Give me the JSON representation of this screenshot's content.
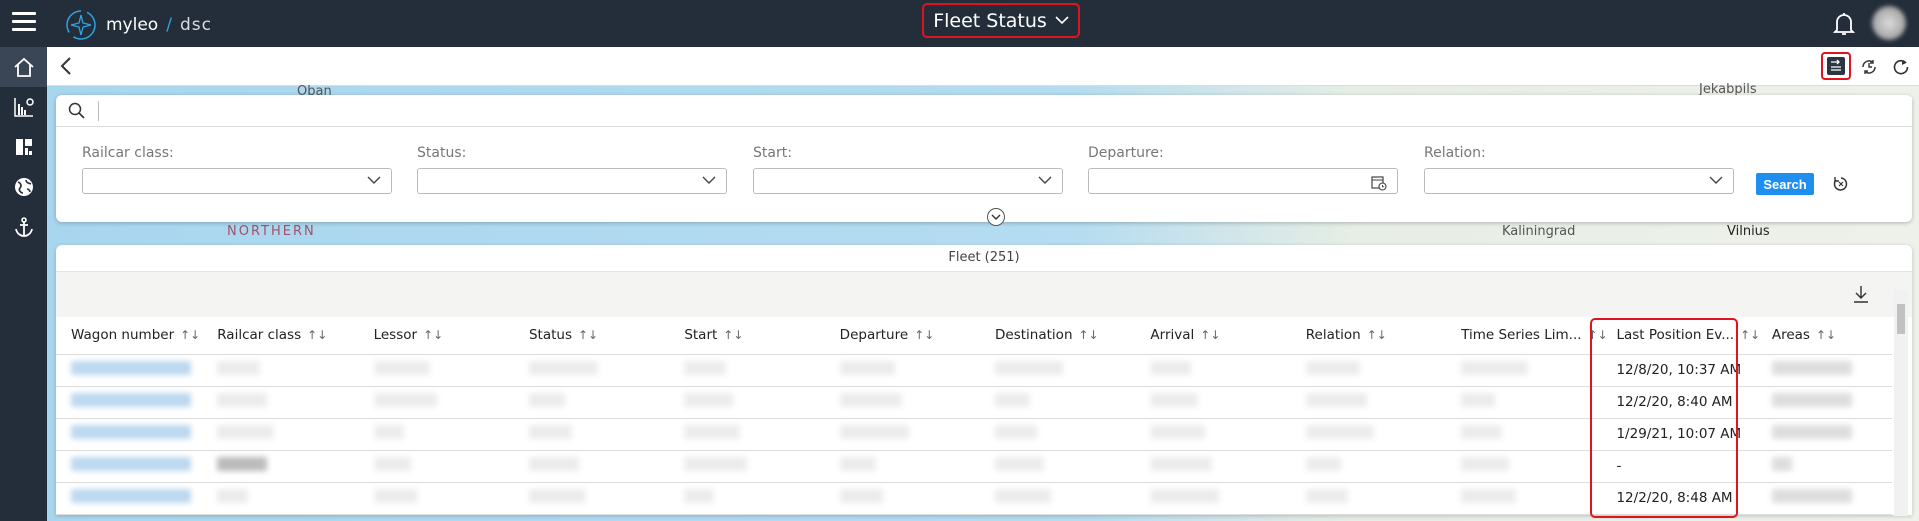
{
  "header": {
    "brand": "myleo",
    "brand_sep": "/",
    "brand_suffix": "dsc",
    "title": "Fleet Status"
  },
  "map_labels": [
    "Oban",
    "NORTHERN",
    "Kaliningrad",
    "Vilnius",
    "Jekabpils"
  ],
  "search": {
    "placeholder": ""
  },
  "filters": [
    {
      "label": "Railcar class:",
      "value": ""
    },
    {
      "label": "Status:",
      "value": ""
    },
    {
      "label": "Start:",
      "value": ""
    },
    {
      "label": "Departure:",
      "value": ""
    },
    {
      "label": "Relation:",
      "value": ""
    }
  ],
  "search_button": "Search",
  "fleet": {
    "title": "Fleet (251)"
  },
  "columns": [
    "Wagon number",
    "Railcar class",
    "Lessor",
    "Status",
    "Start",
    "Departure",
    "Destination",
    "Arrival",
    "Relation",
    "Time Series Lim...",
    "Last Position Ev...",
    "Areas"
  ],
  "sort_glyph": "↑↓",
  "rows": [
    {
      "last_position": "12/8/20, 10:37 AM"
    },
    {
      "last_position": "12/2/20, 8:40 AM"
    },
    {
      "last_position": "1/29/21, 10:07 AM"
    },
    {
      "last_position": "-"
    },
    {
      "last_position": "12/2/20, 8:48 AM"
    }
  ],
  "colors": {
    "topbar": "#242e3a",
    "accent": "#1e8ff0",
    "highlight": "#e0141e"
  }
}
